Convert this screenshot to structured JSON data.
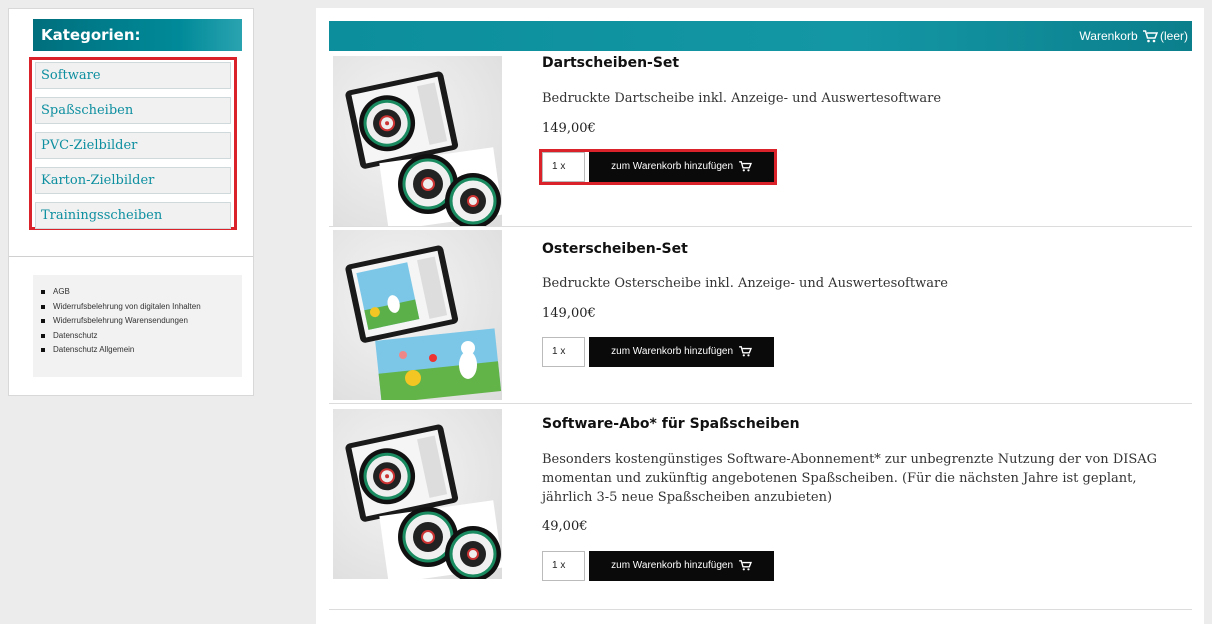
{
  "sidebar": {
    "title": "Kategorien:",
    "categories": [
      "Software",
      "Spaßscheiben",
      "PVC-Zielbilder",
      "Karton-Zielbilder",
      "Trainingsscheiben"
    ],
    "links": [
      "AGB",
      "Widerrufsbelehrung von digitalen Inhalten",
      "Widerrufsbelehrung Warensendungen",
      "Datenschutz",
      "Datenschutz Allgemein"
    ]
  },
  "header": {
    "cart_label": "Warenkorb",
    "cart_status": "(leer)",
    "cart_icon": "shopping-cart-icon"
  },
  "products": [
    {
      "title": "Dartscheiben-Set",
      "description": "Bedruckte Dartscheibe inkl. Anzeige- und Auswertesoftware",
      "price": "149,00€",
      "quantity": "1 x",
      "button": "zum Warenkorb hinzufügen",
      "image": "dartboard-tablet-image"
    },
    {
      "title": "Osterscheiben-Set",
      "description": "Bedruckte Osterscheibe inkl. Anzeige- und Auswertesoftware",
      "price": "149,00€",
      "quantity": "1 x",
      "button": "zum Warenkorb hinzufügen",
      "image": "easter-target-tablet-image"
    },
    {
      "title": "Software-Abo* für Spaßscheiben",
      "description": "Besonders kostengünstiges Software-Abonnement* zur unbegrenzte Nutzung der von DISAG momentan und zukünftig angebotenen Spaßscheiben. (Für die nächsten Jahre ist geplant, jährlich 3-5 neue Spaßscheiben anzubieten)",
      "price": "49,00€",
      "quantity": "1 x",
      "button": "zum Warenkorb hinzufügen",
      "image": "dartboard-tablet-image"
    }
  ],
  "colors": {
    "accent": "#0c8e9c",
    "highlight": "#d9222a",
    "link": "#0d8fa0",
    "button": "#0a0a0a"
  }
}
